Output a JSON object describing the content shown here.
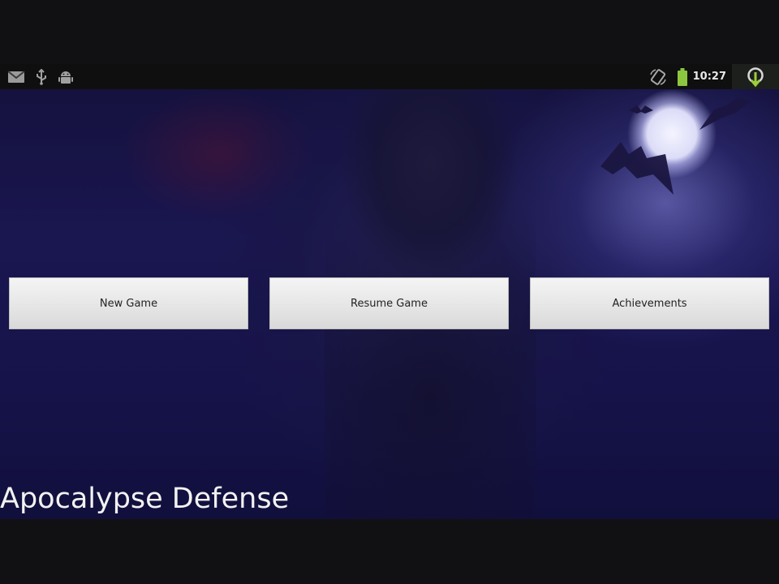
{
  "status_bar": {
    "left_icons": [
      "gmail-icon",
      "usb-icon",
      "android-debug-icon"
    ],
    "right_icons": [
      "screen-rotation-icon",
      "battery-icon",
      "download-icon"
    ],
    "time": "10:27",
    "battery_color": "#8dc63f"
  },
  "game": {
    "title": "Apocalypse Defense",
    "buttons": {
      "new_game": "New Game",
      "resume_game": "Resume Game",
      "achievements": "Achievements"
    }
  }
}
